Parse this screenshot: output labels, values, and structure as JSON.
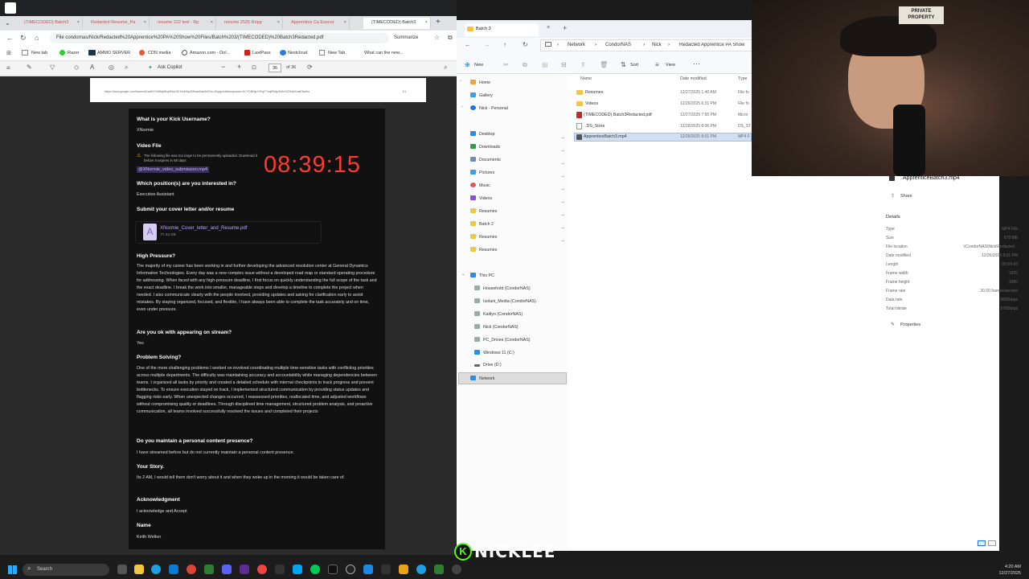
{
  "browser": {
    "tabs": [
      "(TIMECODED) Batch3",
      "Redacted Resume_Pa",
      "resume 222 test - Rp",
      "resume 2525 Ropp",
      "Apprentice Ca Execut",
      "(TIMECODED) Batch3"
    ],
    "address": "File   condornas/Nick/Redacted%20Apprentice%20PA%20Show%20Files/Batch%203/(TIMECODED)%20Batch3Redacted.pdf",
    "summarize": "Summarize",
    "bookmarks": [
      "New tab",
      "Razer",
      "AMMO SERVER",
      "CDN media",
      "Amazon.com - Onl...",
      "LastPass",
      "Nextcloud",
      "New Tab",
      "What can the new..."
    ],
    "ask_copilot": "Ask Copilot",
    "page_current": "36",
    "page_total": "of 36",
    "pdf_url": "https://docs.google.com/forms/d/1adHCVM8qMtny9MoU3r1XdHAp3GleanDwxNCNo-4Xyqp/edit#response=ACYDBNjzYXNyTYzqRKdp3hKcSZ3hkI0LasEfwnhx"
  },
  "form": {
    "q_username": "What is your Kick Username?",
    "a_username": "XNormie",
    "q_video": "Video File",
    "video_warning": "The following file was too large to be permanently uploaded. Download it before it expires in 58 days",
    "video_file": "@XNormie_video_submission.mp4",
    "timer": "08:39:15",
    "q_position": "Which position(s) are you interested in?",
    "a_position": "Executive Assistant",
    "q_cover": "Submit your cover letter and/or resume",
    "cover_file": "XNormie_Cover_letter_and_Resume.pdf",
    "cover_size": "77.42 KB",
    "q_pressure": "High Pressure?",
    "a_pressure": "The majority of my career has been working in and further developing the advanced resolution center at General Dynamics Information Technologies. Every day was a new complex issue without a developed road map or standard operating procedure for addressing. When faced with any high-pressure deadline, I first focus on quickly understanding the full scope of the task and the exact deadline. I break the work into smaller, manageable steps and develop a timeline to complete the project when needed. I also communicate clearly with the people involved, providing updates and asking for clarification early to avoid mistakes. By staying organized, focused, and flexible, I have always been able to complete the task accurately and on time, even under pressure.",
    "q_stream": "Are you ok with appearing on stream?",
    "a_stream": "Yes",
    "q_problem": "Problem Solving?",
    "a_problem": "One of the more challenging problems I worked on involved coordinating multiple time-sensitive tasks with conflicting priorities across multiple departments. The difficulty was maintaining accuracy and accountability while managing dependencies between teams. I organized all tasks by priority and created a detailed schedule with internal checkpoints to track progress and prevent bottlenecks. To ensure execution stayed on track, I implemented structured communication by providing status updates and flagging risks early. When unexpected changes occurred, I reassessed priorities, reallocated time, and adjusted workflows without compromising quality or deadlines. Through disciplined time management, structured problem analysis, and proactive communication, all teams involved successfully resolved the issues and completed their projects",
    "q_content": "Do you maintain a personal content presence?",
    "a_content": "I have streamed before but do not currently maintain a personal content presence.",
    "q_story": "Your Story.",
    "a_story": "Its 2 AM, I would tell them don't worry about it and  when they woke up in the morning it would be taken care of.",
    "q_ack": "Acknowledgment",
    "a_ack": "I acknowledge and Accept",
    "q_name": "Name",
    "a_name": "Keith Welker"
  },
  "explorer": {
    "title": "Batch 3",
    "breadcrumb": [
      "Network",
      "CondorNAS",
      "Nick",
      "Redacted Apprentice PA Show"
    ],
    "cmd_new": "New",
    "cmd_sort": "Sort",
    "cmd_view": "View",
    "col_name": "Name",
    "col_date": "Date modified",
    "col_type": "Type",
    "sidebar": [
      "Home",
      "Gallery",
      "Nick - Personal",
      "Desktop",
      "Downloads",
      "Documents",
      "Pictures",
      "Music",
      "Videos",
      "Resumes",
      "Batch 2",
      "Resumes",
      "Resumes",
      "This PC",
      "Household (CondorNAS)",
      "Isolani_Media (CondorNAS)",
      "Kaitlyn (CondorNAS)",
      "Nick (CondorNAS)",
      "PC_Drives (CondorNAS)",
      "Windows 11 (C:)",
      "Drive (D:)",
      "Network"
    ],
    "files": [
      {
        "name": "Resumes",
        "date": "12/27/2025 1:46 AM",
        "type": "File fo"
      },
      {
        "name": "Videos",
        "date": "12/26/2025 6:31 PM",
        "type": "File fo"
      },
      {
        "name": "(TIMECODED) Batch3Redacted.pdf",
        "date": "12/27/2025 7:55 PM",
        "type": "Micro"
      },
      {
        "name": ".DS_Store",
        "date": "12/26/2025 8:06 PM",
        "type": "DS_ST"
      },
      {
        "name": "ApprenticeBatch3.mp4",
        "date": "12/26/2025 8:01 PM",
        "type": "MP4 F"
      }
    ],
    "detail_title": "ApprenticeBatch3.mp4",
    "share": "Share",
    "details_heading": "Details",
    "details": [
      {
        "k": "Type",
        "v": "MP4 File"
      },
      {
        "k": "Size",
        "v": "678 MB"
      },
      {
        "k": "File location",
        "v": "\\\\CondorNAS\\Nick\\Redacted..."
      },
      {
        "k": "Date modified",
        "v": "12/26/2025 8:01 PM"
      },
      {
        "k": "Length",
        "v": "00:09:43"
      },
      {
        "k": "Frame width",
        "v": "1920"
      },
      {
        "k": "Frame height",
        "v": "1080"
      },
      {
        "k": "Frame rate",
        "v": "30.00 frames/second"
      },
      {
        "k": "Data rate",
        "v": "9582kbps"
      },
      {
        "k": "Total bitrate",
        "v": "9782kbps"
      }
    ],
    "properties": "Properties"
  },
  "overlay": {
    "brand": "NICKLEE",
    "webcam_sign": "PRIVATE PROPERTY"
  },
  "taskbar": {
    "search": "Search",
    "time": "4:20 AM",
    "date": "12/27/2025"
  }
}
